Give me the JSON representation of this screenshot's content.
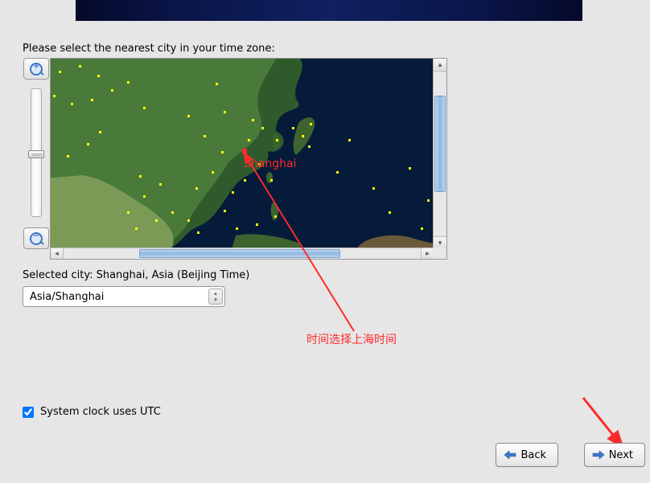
{
  "prompt": "Please select the nearest city in your time zone:",
  "selected_city_label": "Selected city: Shanghai, Asia (Beijing Time)",
  "timezone_value": "Asia/Shanghai",
  "utc_checkbox_label": "System clock uses UTC",
  "utc_checked": true,
  "buttons": {
    "back": "Back",
    "next": "Next"
  },
  "annotation": {
    "city_marker": "Shanghai",
    "note": "时间选择上海时间"
  },
  "map": {
    "selected_city": "Shanghai"
  }
}
